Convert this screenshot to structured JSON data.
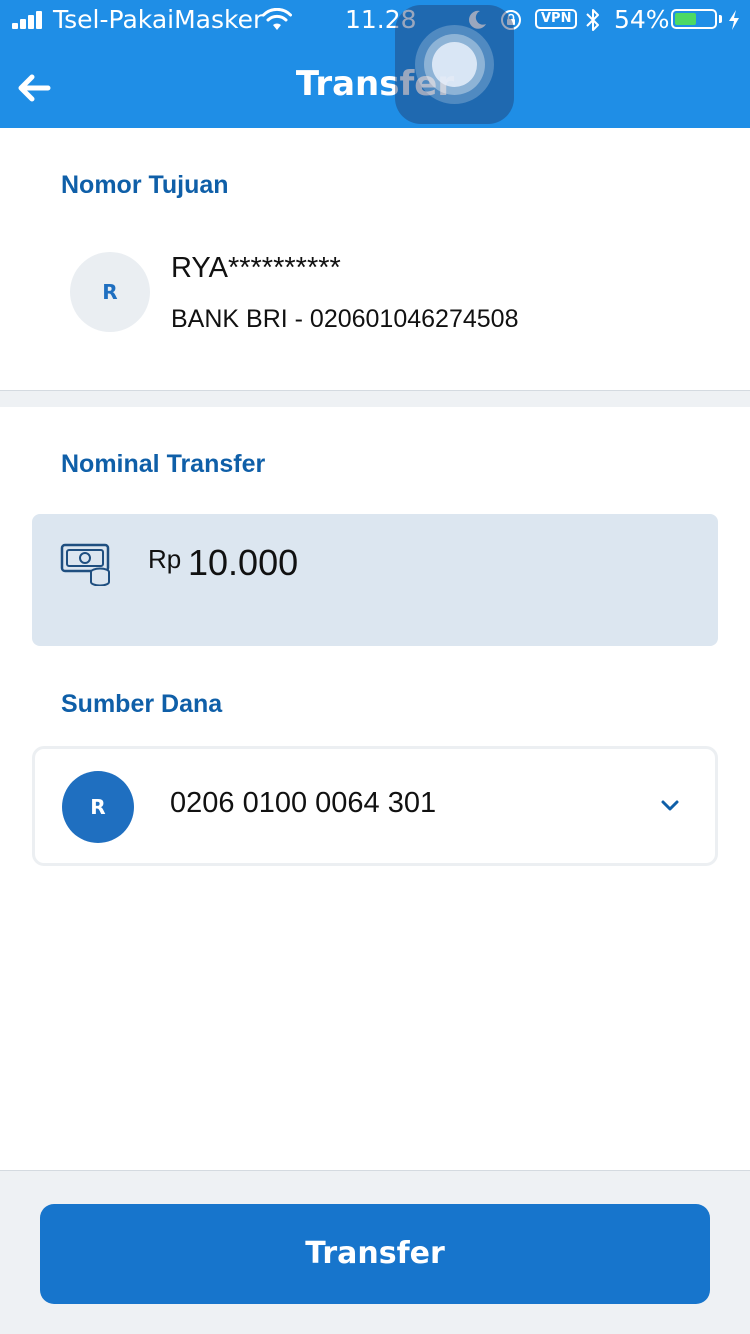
{
  "status_bar": {
    "carrier": "Tsel-PakaiMasker",
    "time": "11.28",
    "vpn": "VPN",
    "battery": "54%",
    "battery_level": 0.54,
    "icons": [
      "signal-icon",
      "wifi-icon",
      "moon-icon",
      "rotation-lock-icon",
      "bluetooth-icon",
      "battery-icon",
      "charging-icon"
    ]
  },
  "header": {
    "title": "Transfer",
    "back_icon": "arrow-left-icon"
  },
  "destination": {
    "section_title": "Nomor Tujuan",
    "avatar_initial": "R",
    "name": "RYA**********",
    "bank_account": "BANK BRI - 020601046274508"
  },
  "amount": {
    "section_title": "Nominal Transfer",
    "icon": "money-icon",
    "currency": "Rp",
    "value": "10.000"
  },
  "source": {
    "section_title": "Sumber Dana",
    "avatar_initial": "R",
    "account_number": "0206 0100 0064 301",
    "dropdown_icon": "chevron-down-icon"
  },
  "footer": {
    "button_label": "Transfer"
  },
  "colors": {
    "header_blue": "#1f8ee6",
    "title_blue": "#0f5fa8",
    "button_blue": "#1775cc",
    "amount_bg": "#dce6f0",
    "battery_green": "#4cd964"
  }
}
